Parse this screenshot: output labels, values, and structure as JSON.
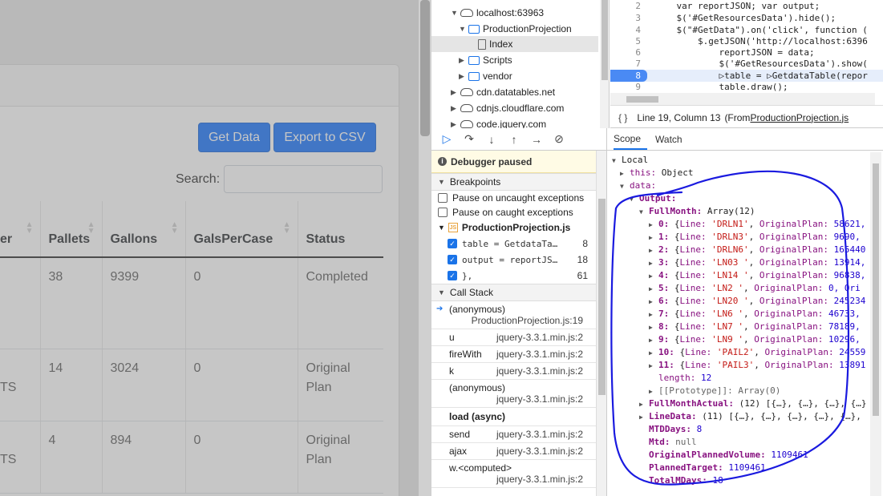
{
  "page": {
    "buttons": {
      "get_data": "Get Data",
      "export_csv": "Export to CSV"
    },
    "search_label": "Search:",
    "table": {
      "columns": [
        "er",
        "Pallets",
        "Gallons",
        "GalsPerCase",
        "Status"
      ],
      "rows": [
        {
          "c0": "",
          "pallets": "38",
          "gallons": "9399",
          "gals_per_case": "0",
          "status": "Completed"
        },
        {
          "c0": "TS",
          "pallets": "14",
          "gallons": "3024",
          "gals_per_case": "0",
          "status": "Original Plan"
        },
        {
          "c0": "TS",
          "pallets": "4",
          "gallons": "894",
          "gals_per_case": "0",
          "status": "Original Plan"
        }
      ]
    }
  },
  "devtools": {
    "navigator": {
      "items": [
        {
          "label": "localhost:63963",
          "icon": "cloud-icon"
        },
        {
          "label": "ProductionProjection",
          "icon": "folder-icon"
        },
        {
          "label": "Index",
          "icon": "file-icon"
        },
        {
          "label": "Scripts",
          "icon": "folder-icon"
        },
        {
          "label": "vendor",
          "icon": "folder-icon"
        },
        {
          "label": "cdn.datatables.net",
          "icon": "cloud-icon"
        },
        {
          "label": "cdnjs.cloudflare.com",
          "icon": "cloud-icon"
        },
        {
          "label": "code.jquery.com",
          "icon": "cloud-icon"
        }
      ]
    },
    "editor": {
      "lines": [
        {
          "num": "2",
          "code": "    var reportJSON; var output;"
        },
        {
          "num": "3",
          "code": "    $('#GetResourcesData').hide();"
        },
        {
          "num": "4",
          "code": "    $(\"#GetData\").on('click', function ("
        },
        {
          "num": "5",
          "code": "        $.getJSON('http://localhost:6396"
        },
        {
          "num": "6",
          "code": "            reportJSON = data;"
        },
        {
          "num": "7",
          "code": "            $('#GetResourcesData').show("
        },
        {
          "num": "8",
          "code": "            ▷table = ▷GetdataTable(repor"
        },
        {
          "num": "9",
          "code": "            table.draw();"
        }
      ],
      "status": "Line 19, Column 13",
      "status_from_prefix": "(From ",
      "status_from_file": "ProductionProjection.js"
    },
    "paused_label": "Debugger paused",
    "breakpoints": {
      "title": "Breakpoints",
      "options": [
        "Pause on uncaught exceptions",
        "Pause on caught exceptions"
      ],
      "file": "ProductionProjection.js",
      "entries": [
        {
          "code": "table = GetdataTa…",
          "line": "8"
        },
        {
          "code": "output = reportJS…",
          "line": "18"
        },
        {
          "code": "},",
          "line": "61"
        }
      ]
    },
    "call_stack": {
      "title": "Call Stack",
      "frames": [
        {
          "fn": "(anonymous)",
          "loc": "ProductionProjection.js:19"
        },
        {
          "fn": "u",
          "loc": "jquery-3.3.1.min.js:2"
        },
        {
          "fn": "fireWith",
          "loc": "jquery-3.3.1.min.js:2"
        },
        {
          "fn": "k",
          "loc": "jquery-3.3.1.min.js:2"
        },
        {
          "fn": "(anonymous)",
          "loc": "jquery-3.3.1.min.js:2"
        }
      ],
      "async_label": "load (async)",
      "frames2": [
        {
          "fn": "send",
          "loc": "jquery-3.3.1.min.js:2"
        },
        {
          "fn": "ajax",
          "loc": "jquery-3.3.1.min.js:2"
        },
        {
          "fn": "w.<computed>",
          "loc": "jquery-3.3.1.min.js:2"
        }
      ]
    },
    "scope": {
      "tabs": [
        "Scope",
        "Watch"
      ],
      "local": "Local",
      "this_key": "this:",
      "this_val": "Object",
      "data_key": "data:",
      "output_key": "Output:",
      "fullmonth_key": "FullMonth:",
      "fullmonth_val": "Array(12)",
      "items": [
        {
          "idx": "0:",
          "line": "'DRLN1'",
          "plan": "58621,"
        },
        {
          "idx": "1:",
          "line": "'DRLN3'",
          "plan": "9690,"
        },
        {
          "idx": "2:",
          "line": "'DRLN6'",
          "plan": "165440"
        },
        {
          "idx": "3:",
          "line": "'LN03 '",
          "plan": "13914,"
        },
        {
          "idx": "4:",
          "line": "'LN14 '",
          "plan": "96838,"
        },
        {
          "idx": "5:",
          "line": "'LN2  '",
          "plan": "0, Ori"
        },
        {
          "idx": "6:",
          "line": "'LN20 '",
          "plan": "245234"
        },
        {
          "idx": "7:",
          "line": "'LN6  '",
          "plan": "46733,"
        },
        {
          "idx": "8:",
          "line": "'LN7  '",
          "plan": "78189,"
        },
        {
          "idx": "9:",
          "line": "'LN9  '",
          "plan": "10296,"
        },
        {
          "idx": "10:",
          "line": "'PAIL2'",
          "plan": "24559"
        },
        {
          "idx": "11:",
          "line": "'PAIL3'",
          "plan": "13891"
        }
      ],
      "length_key": "length:",
      "length_val": "12",
      "prototype": "[[Prototype]]: Array(0)",
      "fullmonthactual_key": "FullMonthActual:",
      "fullmonthactual_val": "(12) [{…}, {…}, {…}, {…}",
      "linedata_key": "LineData:",
      "linedata_val": "(11) [{…}, {…}, {…}, {…}, {…},",
      "mtddays_key": "MTDDays:",
      "mtddays_val": "8",
      "mtd_key": "Mtd:",
      "mtd_val": "null",
      "opv_key": "OriginalPlannedVolume:",
      "opv_val": "1109461",
      "pt_key": "PlannedTarget:",
      "pt_val": "1109461",
      "tmd_key": "TotalMDays:",
      "tmd_val": "18"
    }
  }
}
